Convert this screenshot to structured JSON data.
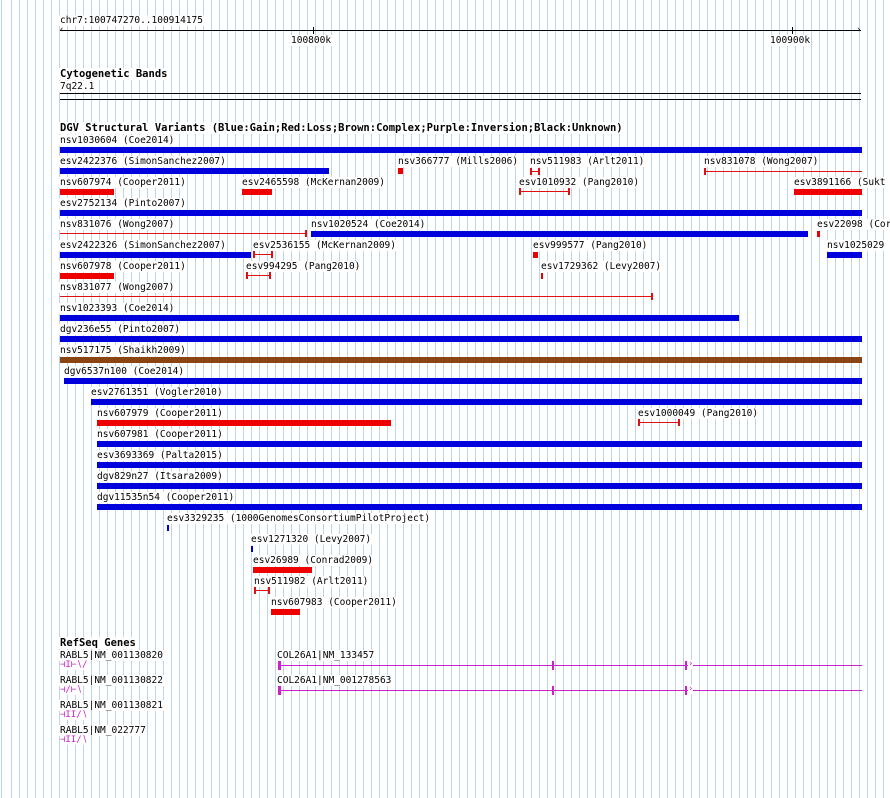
{
  "ruler": {
    "location": "chr7:100747270..100914175",
    "tick_left": "100800k",
    "tick_right": "100900k"
  },
  "cytoband": {
    "title": "Cytogenetic Bands",
    "band": "7q22.1"
  },
  "dgv": {
    "title": "DGV Structural Variants (Blue:Gain;Red:Loss;Brown:Complex;Purple:Inversion;Black:Unknown)",
    "colors": {
      "gain": "#0000dd",
      "loss": "#ee0000",
      "complex": "#8b4513"
    },
    "labels": [
      "nsv1030604 (Coe2014)",
      "esv2422376 (SimonSanchez2007)",
      "nsv366777 (Mills2006)",
      "nsv511983 (Arlt2011)",
      "nsv831078 (Wong2007)",
      "nsv607974 (Cooper2011)",
      "esv2465598 (McKernan2009)",
      "esv1010932 (Pang2010)",
      "esv3891166 (Sukt",
      "esv2752134 (Pinto2007)",
      "nsv831076 (Wong2007)",
      "nsv1020524 (Coe2014)",
      "esv22098 (Cor",
      "esv2422326 (SimonSanchez2007)",
      "esv2536155 (McKernan2009)",
      "esv999577 (Pang2010)",
      "nsv1025029",
      "nsv607978 (Cooper2011)",
      "esv994295 (Pang2010)",
      "esv1729362 (Levy2007)",
      "nsv831077 (Wong2007)",
      "nsv1023393 (Coe2014)",
      "dgv236e55 (Pinto2007)",
      "nsv517175 (Shaikh2009)",
      "dgv6537n100 (Coe2014)",
      "esv2761351 (Vogler2010)",
      "nsv607979 (Cooper2011)",
      "esv1000049 (Pang2010)",
      "nsv607981 (Cooper2011)",
      "esv3693369 (Palta2015)",
      "dgv829n27 (Itsara2009)",
      "dgv11535n54 (Cooper2011)",
      "esv3329235 (1000GenomesConsortiumPilotProject)",
      "esv1271320 (Levy2007)",
      "esv26989 (Conrad2009)",
      "nsv511982 (Arlt2011)",
      "nsv607983 (Cooper2011)"
    ]
  },
  "refseq": {
    "title": "RefSeq Genes",
    "gene_color": "#cc22cc",
    "labels": [
      "RABL5|NM_001130820",
      "COL26A1|NM_133457",
      "RABL5|NM_001130822",
      "COL26A1|NM_001278563",
      "RABL5|NM_001130821",
      "RABL5|NM_022777"
    ]
  }
}
